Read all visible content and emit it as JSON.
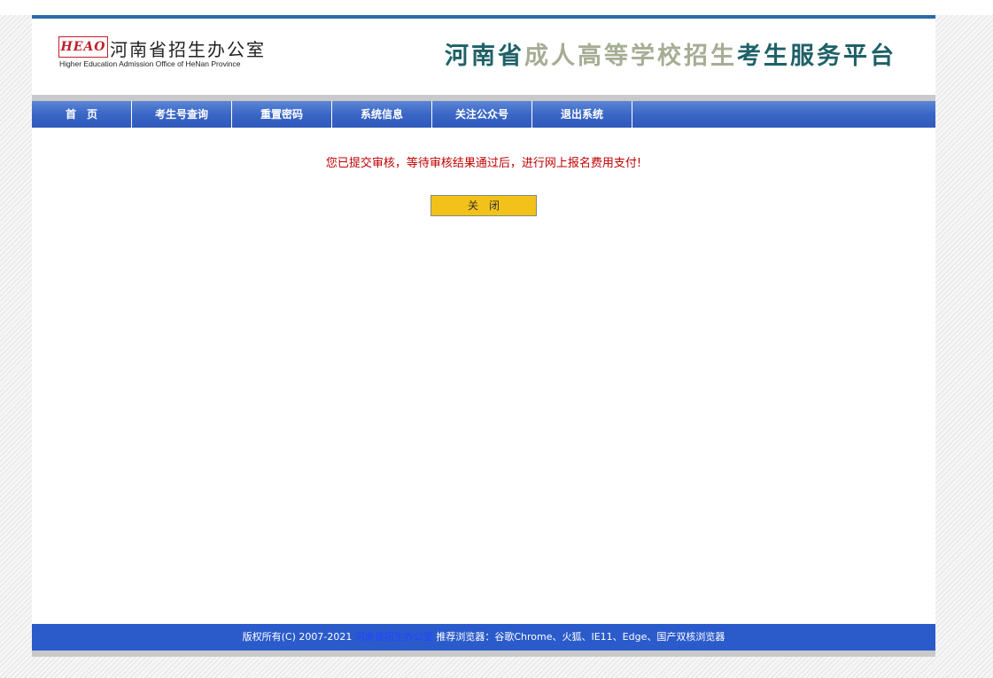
{
  "header": {
    "logo_mark": "HEAO",
    "logo_name": "河南省招生办公室",
    "logo_subtitle": "Higher Education Admission Office of HeNan Province",
    "platform_title": {
      "part1": "河南省",
      "part2": "成人高等学校招生",
      "part3": "考生服务平台"
    }
  },
  "nav": {
    "items": [
      "首　页",
      "考生号查询",
      "重置密码",
      "系统信息",
      "关注公众号",
      "退出系统"
    ]
  },
  "main": {
    "message": "您已提交审核，等待审核结果通过后，进行网上报名费用支付!",
    "close_label": "关　闭"
  },
  "footer": {
    "copyright": "版权所有(C) 2007-2021",
    "org_link": "河南省招生办公室",
    "browsers": "推荐浏览器：谷歌Chrome、火狐、IE11、Edge、国产双核浏览器"
  },
  "colors": {
    "nav_blue": "#3a66c6",
    "footer_blue": "#2b5bcb",
    "header_line": "#2a6aa8",
    "title_dark": "#1f6168",
    "title_light": "#a6ad94",
    "message_red": "#c00000",
    "button_yellow": "#f2c21a"
  }
}
